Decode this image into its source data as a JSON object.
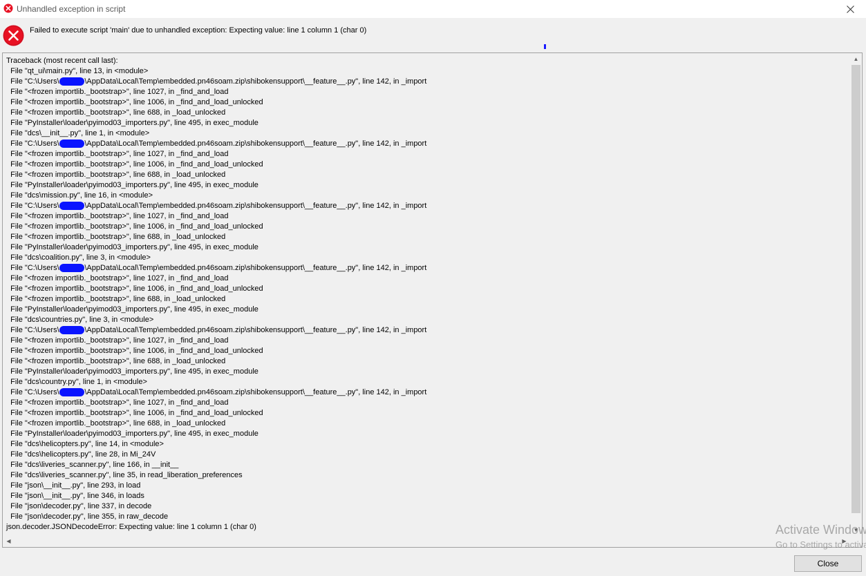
{
  "window": {
    "title": "Unhandled exception in script",
    "title_icon": "error-icon"
  },
  "message": {
    "text": "Failed to execute script 'main' due to unhandled exception: Expecting value: line 1 column 1 (char 0)",
    "icon": "error-icon"
  },
  "traceback": {
    "lines": [
      "Traceback (most recent call last):",
      "  File \"qt_ui\\main.py\", line 13, in <module>",
      "  File \"C:\\Users\\            \\AppData\\Local\\Temp\\embedded.pn46soam.zip\\shibokensupport\\__feature__.py\", line 142, in _import",
      "  File \"<frozen importlib._bootstrap>\", line 1027, in _find_and_load",
      "  File \"<frozen importlib._bootstrap>\", line 1006, in _find_and_load_unlocked",
      "  File \"<frozen importlib._bootstrap>\", line 688, in _load_unlocked",
      "  File \"PyInstaller\\loader\\pyimod03_importers.py\", line 495, in exec_module",
      "  File \"dcs\\__init__.py\", line 1, in <module>",
      "  File \"C:\\Users\\            \\AppData\\Local\\Temp\\embedded.pn46soam.zip\\shibokensupport\\__feature__.py\", line 142, in _import",
      "  File \"<frozen importlib._bootstrap>\", line 1027, in _find_and_load",
      "  File \"<frozen importlib._bootstrap>\", line 1006, in _find_and_load_unlocked",
      "  File \"<frozen importlib._bootstrap>\", line 688, in _load_unlocked",
      "  File \"PyInstaller\\loader\\pyimod03_importers.py\", line 495, in exec_module",
      "  File \"dcs\\mission.py\", line 16, in <module>",
      "  File \"C:\\Users\\            \\AppData\\Local\\Temp\\embedded.pn46soam.zip\\shibokensupport\\__feature__.py\", line 142, in _import",
      "  File \"<frozen importlib._bootstrap>\", line 1027, in _find_and_load",
      "  File \"<frozen importlib._bootstrap>\", line 1006, in _find_and_load_unlocked",
      "  File \"<frozen importlib._bootstrap>\", line 688, in _load_unlocked",
      "  File \"PyInstaller\\loader\\pyimod03_importers.py\", line 495, in exec_module",
      "  File \"dcs\\coalition.py\", line 3, in <module>",
      "  File \"C:\\Users\\            \\AppData\\Local\\Temp\\embedded.pn46soam.zip\\shibokensupport\\__feature__.py\", line 142, in _import",
      "  File \"<frozen importlib._bootstrap>\", line 1027, in _find_and_load",
      "  File \"<frozen importlib._bootstrap>\", line 1006, in _find_and_load_unlocked",
      "  File \"<frozen importlib._bootstrap>\", line 688, in _load_unlocked",
      "  File \"PyInstaller\\loader\\pyimod03_importers.py\", line 495, in exec_module",
      "  File \"dcs\\countries.py\", line 3, in <module>",
      "  File \"C:\\Users\\            \\AppData\\Local\\Temp\\embedded.pn46soam.zip\\shibokensupport\\__feature__.py\", line 142, in _import",
      "  File \"<frozen importlib._bootstrap>\", line 1027, in _find_and_load",
      "  File \"<frozen importlib._bootstrap>\", line 1006, in _find_and_load_unlocked",
      "  File \"<frozen importlib._bootstrap>\", line 688, in _load_unlocked",
      "  File \"PyInstaller\\loader\\pyimod03_importers.py\", line 495, in exec_module",
      "  File \"dcs\\country.py\", line 1, in <module>",
      "  File \"C:\\Users\\            \\AppData\\Local\\Temp\\embedded.pn46soam.zip\\shibokensupport\\__feature__.py\", line 142, in _import",
      "  File \"<frozen importlib._bootstrap>\", line 1027, in _find_and_load",
      "  File \"<frozen importlib._bootstrap>\", line 1006, in _find_and_load_unlocked",
      "  File \"<frozen importlib._bootstrap>\", line 688, in _load_unlocked",
      "  File \"PyInstaller\\loader\\pyimod03_importers.py\", line 495, in exec_module",
      "  File \"dcs\\helicopters.py\", line 14, in <module>",
      "  File \"dcs\\helicopters.py\", line 28, in Mi_24V",
      "  File \"dcs\\liveries_scanner.py\", line 166, in __init__",
      "  File \"dcs\\liveries_scanner.py\", line 35, in read_liberation_preferences",
      "  File \"json\\__init__.py\", line 293, in load",
      "  File \"json\\__init__.py\", line 346, in loads",
      "  File \"json\\decoder.py\", line 337, in decode",
      "  File \"json\\decoder.py\", line 355, in raw_decode",
      "json.decoder.JSONDecodeError: Expecting value: line 1 column 1 (char 0)"
    ],
    "redacted_color": "#0a14ff"
  },
  "watermark": {
    "line1": "Activate Windows",
    "line2": "Go to Settings to activate Windows."
  },
  "buttons": {
    "close_label": "Close"
  },
  "colors": {
    "error_red": "#e81123",
    "background": "#f0f0f0"
  }
}
